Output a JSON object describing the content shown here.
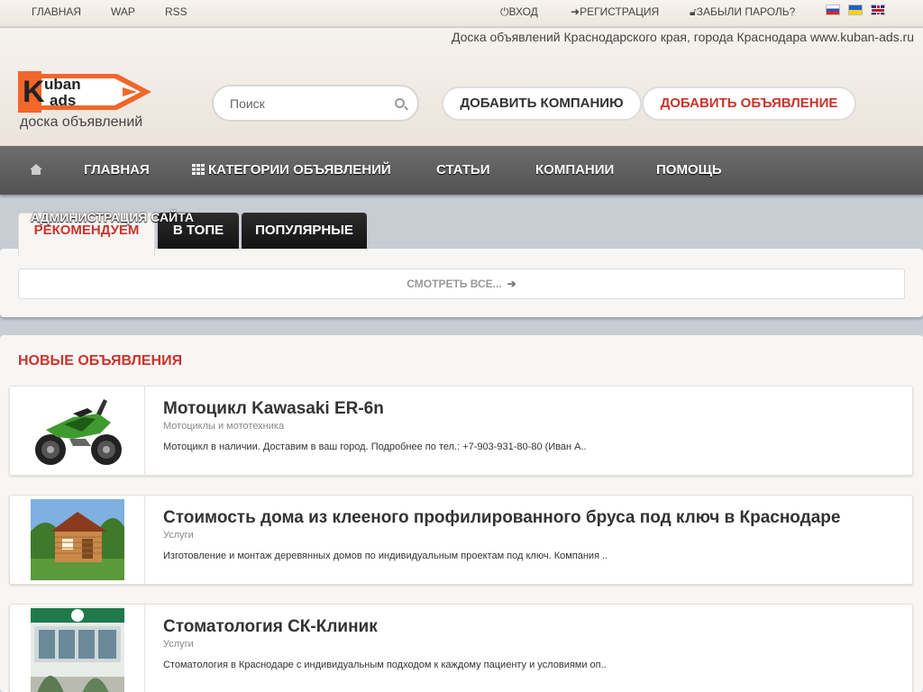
{
  "topbar": {
    "links": [
      "ГЛАВНАЯ",
      "WAP",
      "RSS"
    ],
    "login": "ВХОД",
    "register": "РЕГИСТРАЦИЯ",
    "forgot": "ЗАБЫЛИ ПАРОЛЬ?",
    "flags": [
      "ru-flag",
      "ua-flag",
      "en-flag"
    ]
  },
  "header": {
    "tagline": "Доска объявлений Краснодарского края, города Краснодара www.kuban-ads.ru",
    "logo_k": "K",
    "logo_kuban": "uban",
    "logo_ads": "ads",
    "logo_sub": "доска объявлений",
    "search_placeholder": "Поиск",
    "add_company": "ДОБАВИТЬ КОМПАНИЮ",
    "add_ad": "ДОБАВИТЬ ОБЪЯВЛЕНИЕ"
  },
  "nav": {
    "items": [
      "ГЛАВНАЯ",
      "КАТЕГОРИИ ОБЪЯВЛЕНИЙ",
      "СТАТЬИ",
      "КОМПАНИИ",
      "ПОМОЩЬ"
    ]
  },
  "tabs": {
    "admin_label": "АДМИНИСТРАЦИЯ САЙТА",
    "recommend": "РЕКОМЕНДУЕМ",
    "top": "В ТОПЕ",
    "popular": "ПОПУЛЯРНЫЕ",
    "view_all": "СМОТРЕТЬ ВСЕ..."
  },
  "new_ads": {
    "heading": "НОВЫЕ ОБЪЯВЛЕНИЯ",
    "items": [
      {
        "title": "Мотоцикл Kawasaki ER-6n",
        "category": "Мотоциклы и мототехника",
        "desc": "Мотоцикл в наличии. Доставим в ваш город. Подробнее по тел.: +7-903-931-80-80 (Иван А.."
      },
      {
        "title": "Стоимость дома из клееного профилированного бруса под ключ в Краснодаре",
        "category": "Услуги",
        "desc": "Изготовление и монтаж деревянных домов по индивидуальным проектам под ключ. Компания .."
      },
      {
        "title": "Стоматология СК-Клиник",
        "category": "Услуги",
        "desc": "Стоматология в Краснодаре с индивидуальным подходом к каждому пациенту и условиями оп.."
      }
    ]
  },
  "colors": {
    "accent": "#c9342c",
    "logo_orange": "#f2662a",
    "nav": "#5e5e5e"
  }
}
